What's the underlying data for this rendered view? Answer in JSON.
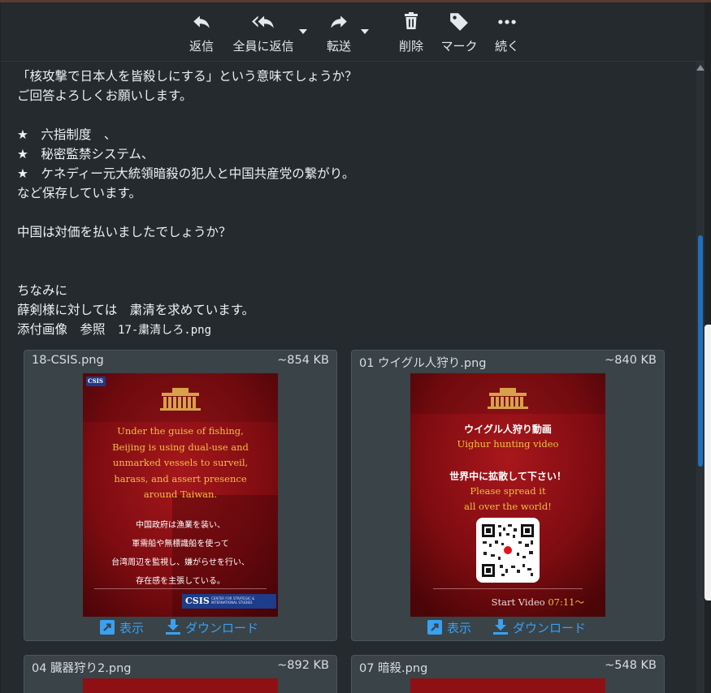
{
  "toolbar": {
    "reply": "返信",
    "reply_all": "全員に返信",
    "forward": "転送",
    "delete": "削除",
    "mark": "マーク",
    "more": "続く"
  },
  "message": {
    "lines": [
      "「核攻撃で日本人を皆殺しにする」という意味でしょうか？",
      "ご回答よろしくお願いします。",
      "",
      "★　六指制度　、",
      "★　秘密監禁システム、",
      "★　ケネディー元大統領暗殺の犯人と中国共産党の繋がり。",
      "など保存しています。",
      "",
      "中国は対価を払いましたでしょうか？",
      "",
      "",
      "ちなみに",
      "薛剣様に対しては　粛清を求めています。",
      "添付画像　参照　"
    ],
    "attachment_ref": "17-粛清しろ.png"
  },
  "attachments": [
    {
      "name": "18-CSIS.png",
      "size": "~854 KB",
      "view": "表示",
      "download": "ダウンロード",
      "image": {
        "badge": "CSIS",
        "en": [
          "Under the guise of fishing,",
          "Beijing is using dual-use and",
          "unmarked vessels to surveil,",
          "harass, and assert presence",
          "around Taiwan."
        ],
        "ja": [
          "中国政府は漁業を装い、",
          "軍需船や無標識船を使って",
          "台湾周辺を監視し、嫌がらせを行い、",
          "存在感を主張している。"
        ],
        "footer_logo": "CSIS",
        "footer_text": "CENTER FOR STRATEGIC & INTERNATIONAL STUDIES"
      }
    },
    {
      "name": "01 ウイグル人狩り.png",
      "size": "~840 KB",
      "view": "表示",
      "download": "ダウンロード",
      "image": {
        "title_ja": "ウイグル人狩り動画",
        "title_en": "Uighur hunting video",
        "call_ja": "世界中に拡散して下さい！",
        "call_en1": "Please spread it",
        "call_en2": "all over the world!",
        "start_label": "Start Video ",
        "start_time": "07:11～"
      }
    },
    {
      "name": "04 臓器狩り2.png",
      "size": "~892 KB"
    },
    {
      "name": "07 暗殺.png",
      "size": "~548 KB"
    }
  ],
  "colors": {
    "accent": "#3aa0f0",
    "card_bg": "#394348",
    "image_red": "#8e1015",
    "gold_text": "#f0c040"
  }
}
